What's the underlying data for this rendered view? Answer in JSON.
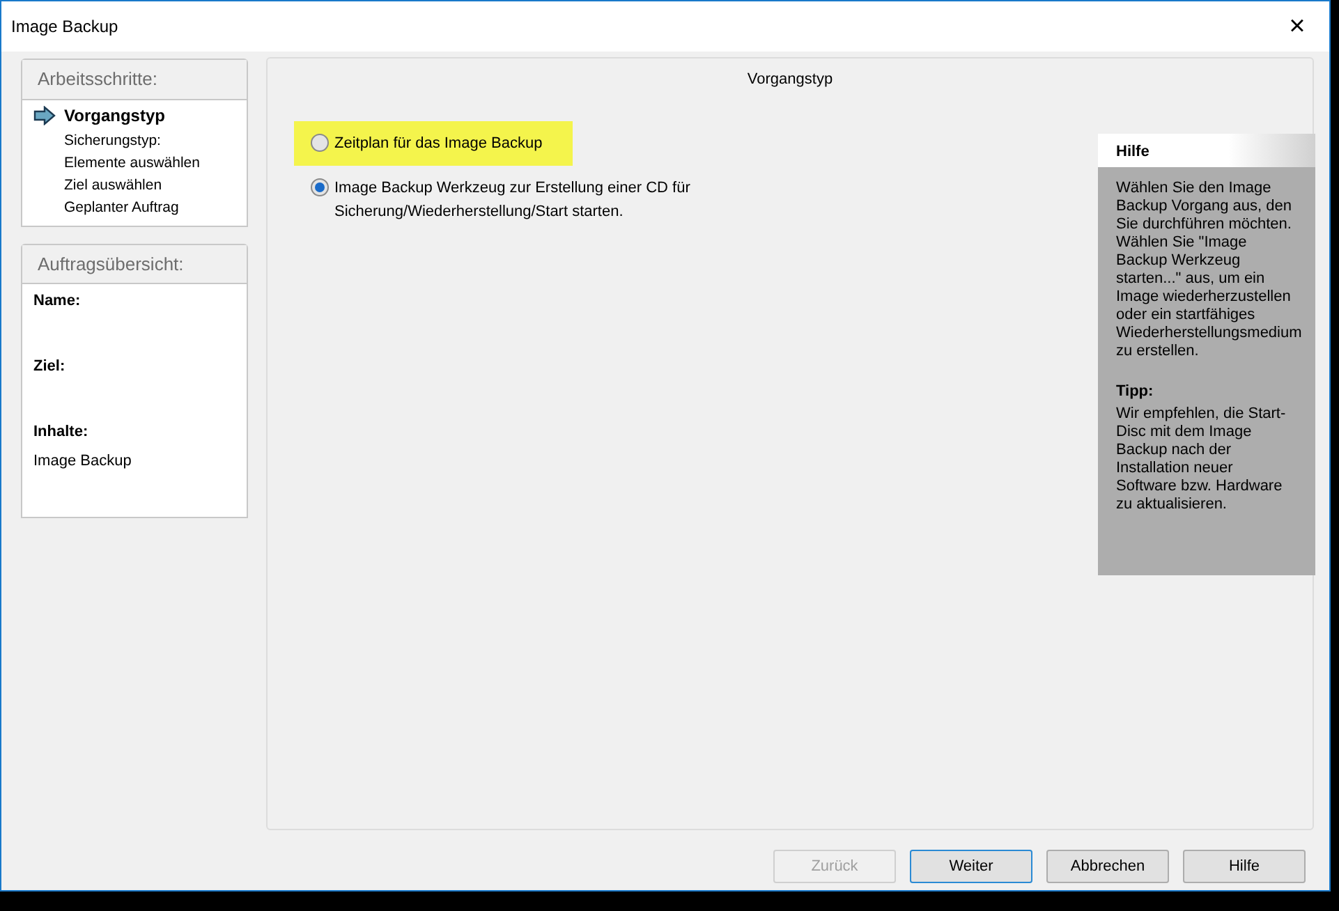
{
  "window": {
    "title": "Image Backup",
    "close": "×"
  },
  "steps": {
    "title": "Arbeitsschritte:",
    "items": [
      {
        "label": "Vorgangstyp",
        "selected": true
      },
      {
        "label": "Sicherungstyp:",
        "selected": false
      },
      {
        "label": "Elemente auswählen",
        "selected": false
      },
      {
        "label": "Ziel auswählen",
        "selected": false
      },
      {
        "label": "Geplanter Auftrag",
        "selected": false
      }
    ]
  },
  "summary": {
    "title": "Auftragsübersicht:",
    "fields": [
      {
        "label": "Name:"
      },
      {
        "label": "Ziel:"
      },
      {
        "label": "Inhalte:",
        "value": "Image Backup"
      }
    ]
  },
  "main": {
    "heading": "Vorgangstyp",
    "options": [
      {
        "label": "Zeitplan für das Image Backup",
        "selected": false,
        "highlighted": true
      },
      {
        "label": "Image Backup Werkzeug zur Erstellung einer CD für Sicherung/Wiederherstellung/Start starten.",
        "selected": true,
        "highlighted": false
      }
    ]
  },
  "help": {
    "title": "Hilfe",
    "text": "Wählen Sie den Image Backup Vorgang aus, den Sie durchführen möchten. Wählen Sie \"Image Backup Werkzeug starten...\" aus, um ein Image wiederherzustellen oder ein startfähiges Wiederherstellungsmedium zu erstellen.",
    "tip_title": "Tipp:",
    "tip_text": "Wir empfehlen, die Start-Disc mit dem Image Backup nach der Installation neuer Software bzw. Hardware zu aktualisieren."
  },
  "buttons": [
    {
      "label": "Zurück",
      "disabled": true,
      "default": false
    },
    {
      "label": "Weiter",
      "disabled": false,
      "default": true
    },
    {
      "label": "Abbrechen",
      "disabled": false,
      "default": false
    },
    {
      "label": "Hilfe",
      "disabled": false,
      "default": false
    }
  ]
}
